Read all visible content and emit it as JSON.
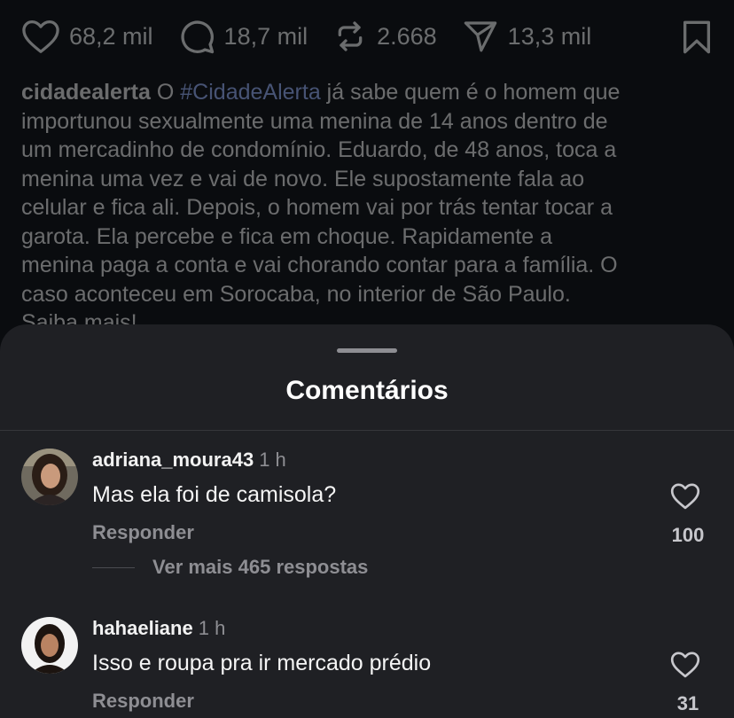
{
  "post": {
    "likes": "68,2 mil",
    "comments": "18,7 mil",
    "reposts": "2.668",
    "shares": "13,3 mil",
    "caption_user": "cidadealerta",
    "caption_pre": "O",
    "caption_hashtag": "#CidadeAlerta",
    "caption_lines": [
      "já sabe quem é o homem que",
      "importunou sexualmente uma menina de 14 anos dentro de",
      "um mercadinho de condomínio. Eduardo, de 48 anos, toca a",
      "menina uma vez e vai de novo. Ele supostamente fala ao",
      "celular e fica ali. Depois, o homem vai por trás tentar tocar a",
      "garota. Ela percebe e fica em choque. Rapidamente a",
      "menina paga a conta e vai chorando contar para a família. O",
      "caso aconteceu em Sorocaba, no interior de São Paulo.",
      "Saiba mais!"
    ]
  },
  "sheet": {
    "title": "Comentários"
  },
  "comments": [
    {
      "user": "adriana_moura43",
      "time": "1 h",
      "text": "Mas ela foi de camisola?",
      "reply_label": "Responder",
      "likes": "100",
      "more_replies": "Ver mais 465 respostas"
    },
    {
      "user": "hahaeliane",
      "time": "1 h",
      "text": "Isso e roupa pra ir mercado prédio",
      "reply_label": "Responder",
      "likes": "31"
    }
  ],
  "colors": {
    "background": "#0a0c0f",
    "sheet": "#1f2024",
    "hashtag": "#9bb6ff",
    "muted": "#8e8e93"
  }
}
